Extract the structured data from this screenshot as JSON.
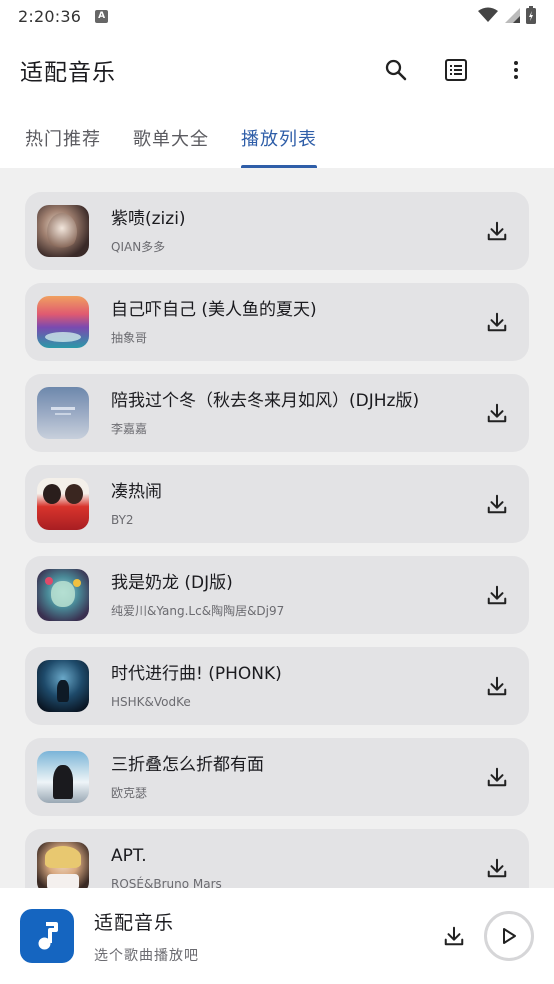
{
  "status_bar": {
    "time": "2:20:36",
    "indicator": "A"
  },
  "app_bar": {
    "title": "适配音乐",
    "icons": [
      "search-icon",
      "list-icon",
      "more-vert-icon"
    ]
  },
  "tabs": [
    {
      "label": "热门推荐",
      "active": false
    },
    {
      "label": "歌单大全",
      "active": false
    },
    {
      "label": "播放列表",
      "active": true
    }
  ],
  "playlist": [
    {
      "title": "紫啧(zizi)",
      "artist": "QIAN多多"
    },
    {
      "title": "自己吓自己 (美人鱼的夏天)",
      "artist": "抽象哥"
    },
    {
      "title": "陪我过个冬（秋去冬来月如风）(DJHz版)",
      "artist": "李嘉嘉"
    },
    {
      "title": "凑热闹",
      "artist": "BY2"
    },
    {
      "title": "我是奶龙 (DJ版)",
      "artist": "纯爱川&Yang.Lc&陶陶居&Dj97"
    },
    {
      "title": "时代进行曲! (PHONK)",
      "artist": "HSHK&VodKe"
    },
    {
      "title": "三折叠怎么折都有面",
      "artist": "欧克瑟"
    },
    {
      "title": "APT.",
      "artist": "ROSÉ&Bruno Mars"
    }
  ],
  "player": {
    "title": "适配音乐",
    "subtitle": "选个歌曲播放吧"
  },
  "colors": {
    "accent": "#2f5ea8",
    "card": "#e3e3e5",
    "background": "#f0f0f0",
    "player_art": "#1565c0"
  }
}
